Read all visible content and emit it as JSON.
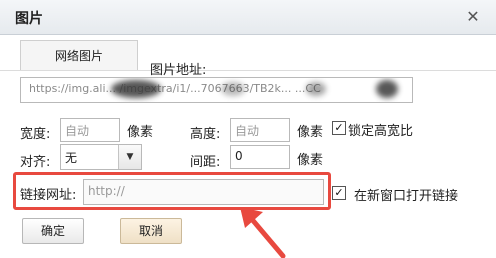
{
  "dialog": {
    "title": "图片",
    "close_icon": "close-icon"
  },
  "tab": {
    "label": "网络图片"
  },
  "image_url": {
    "label": "图片地址:",
    "value": "https://img.ali... /imgextra/i1/...7067663/TB2k... ...CC"
  },
  "width": {
    "label": "宽度:",
    "placeholder": "自动",
    "unit": "像素"
  },
  "height": {
    "label": "高度:",
    "placeholder": "自动",
    "unit": "像素"
  },
  "lock_ratio": {
    "label": "锁定高宽比",
    "checked": true
  },
  "align": {
    "label": "对齐:",
    "value": "无"
  },
  "spacing": {
    "label": "间距:",
    "value": "0",
    "unit": "像素"
  },
  "link": {
    "label": "链接网址:",
    "placeholder": "http://"
  },
  "new_window": {
    "label": "在新窗口打开链接",
    "checked": true
  },
  "buttons": {
    "ok": "确定",
    "cancel": "取消"
  },
  "colors": {
    "highlight": "#e8493f",
    "arrow": "#e8493f"
  }
}
